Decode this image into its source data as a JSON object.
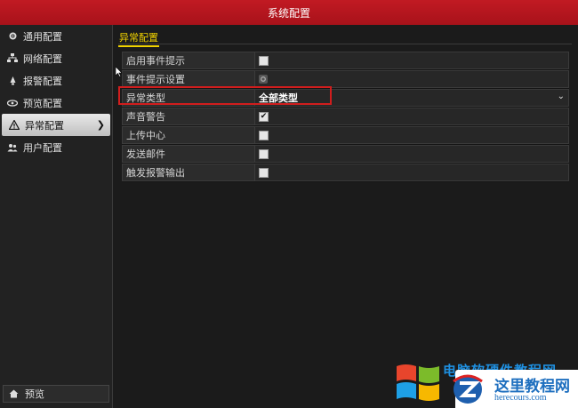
{
  "window": {
    "title": "系统配置"
  },
  "sidebar": {
    "items": [
      {
        "label": "通用配置",
        "icon": "gear-icon"
      },
      {
        "label": "网络配置",
        "icon": "network-icon"
      },
      {
        "label": "报警配置",
        "icon": "alarm-icon"
      },
      {
        "label": "预览配置",
        "icon": "eye-icon"
      },
      {
        "label": "异常配置",
        "icon": "warning-icon",
        "active": true
      },
      {
        "label": "用户配置",
        "icon": "users-icon"
      }
    ],
    "bottom_label": "预览"
  },
  "main": {
    "tab": "异常配置",
    "rows": [
      {
        "label": "启用事件提示",
        "type": "checkbox",
        "checked": false
      },
      {
        "label": "事件提示设置",
        "type": "button"
      },
      {
        "label": "异常类型",
        "type": "select",
        "value": "全部类型"
      },
      {
        "label": "声音警告",
        "type": "checkbox",
        "checked": true
      },
      {
        "label": "上传中心",
        "type": "checkbox",
        "checked": false
      },
      {
        "label": "发送邮件",
        "type": "checkbox",
        "checked": false
      },
      {
        "label": "触发报警输出",
        "type": "checkbox",
        "checked": false
      }
    ]
  },
  "watermark": {
    "line1": "电脑软硬件教程网",
    "line2": "这里教程网",
    "line3": "herecours.com"
  },
  "colors": {
    "titlebar": "#b5161f",
    "tab_accent": "#f0d200",
    "highlight": "#d11d1d",
    "watermark_blue": "#1e6fbf"
  }
}
